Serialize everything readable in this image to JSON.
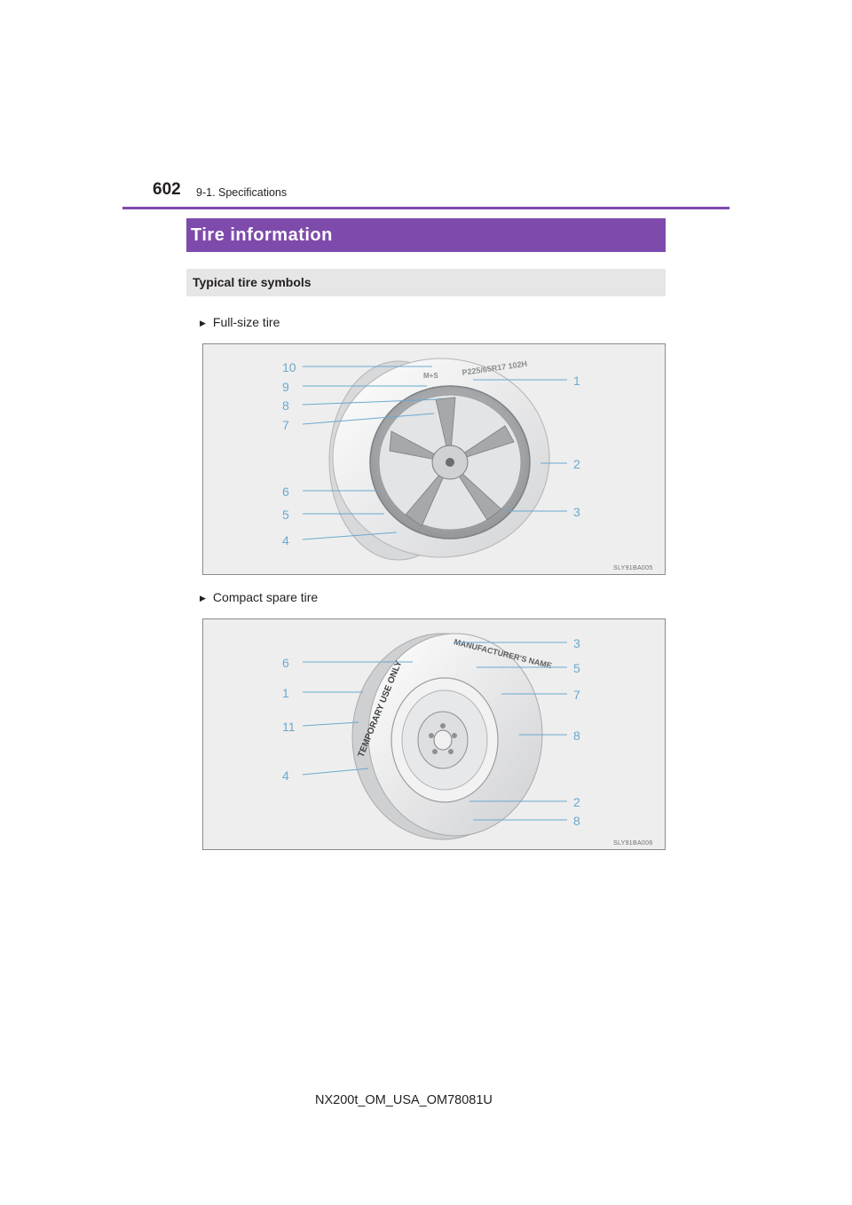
{
  "header": {
    "page_number": "602",
    "section": "9-1. Specifications"
  },
  "title": "Tire information",
  "subtitle": "Typical tire symbols",
  "figures": [
    {
      "caption": "Full-size tire",
      "id": "SLY91BA005",
      "tire_text": "P225/65R17 102H",
      "ms_mark": "M+S",
      "callouts_left": [
        "10",
        "9",
        "8",
        "7",
        "6",
        "5",
        "4"
      ],
      "callouts_right": [
        "1",
        "2",
        "3"
      ]
    },
    {
      "caption": "Compact spare tire",
      "id": "SLY91BA006",
      "band_text": "TEMPORARY USE ONLY",
      "brand_text": "MANUFACTURER'S NAME",
      "callouts_left": [
        "6",
        "1",
        "11",
        "4"
      ],
      "callouts_right": [
        "3",
        "5",
        "7",
        "8",
        "2",
        "8"
      ]
    }
  ],
  "footer": "NX200t_OM_USA_OM78081U"
}
